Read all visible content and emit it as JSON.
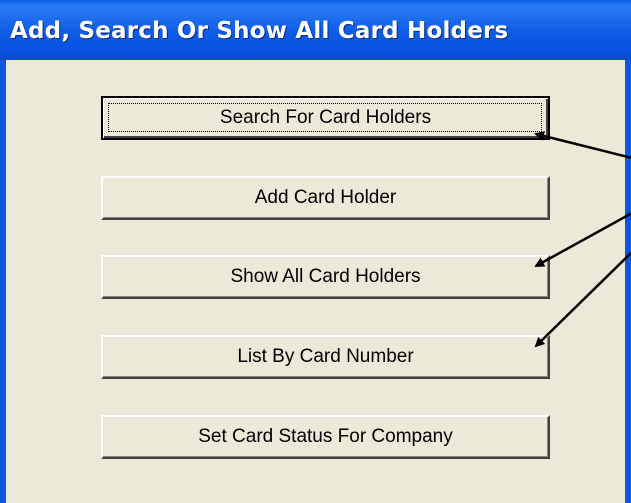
{
  "window": {
    "title": "Add, Search Or Show All Card Holders"
  },
  "buttons": {
    "search": "Search For Card Holders",
    "add": "Add Card Holder",
    "show_all": "Show All Card Holders",
    "list_by_number": "List By Card Number",
    "set_status": "Set Card Status For Company"
  },
  "colors": {
    "titlebar": "#0a5ee8",
    "client_background": "#ece9d8",
    "annotation_arrow": "#000000"
  }
}
